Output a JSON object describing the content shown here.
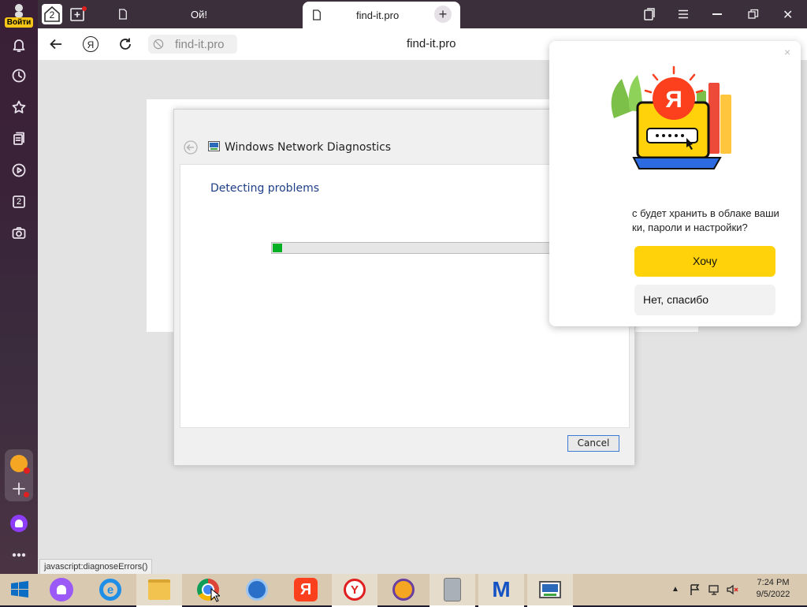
{
  "sidebar": {
    "login_label": "Войти",
    "badge_count": "2"
  },
  "tabs": {
    "group_count": "2",
    "tab1_title": "Ой!",
    "tab2_title": "find-it.pro"
  },
  "toolbar": {
    "address": "find-it.pro",
    "page_title": "find-it.pro"
  },
  "dialog": {
    "title": "Windows Network Diagnostics",
    "heading": "Detecting problems",
    "progress_fraction": 0.035,
    "cancel_label": "Cancel",
    "close_label": "×"
  },
  "popup": {
    "message": "с будет хранить в облаке ваши\nки, пароли и настройки?",
    "yes_label": "Хочу",
    "no_label": "Нет, спасибо",
    "close_label": "×"
  },
  "status": {
    "link": "javascript:diagnoseErrors()"
  },
  "taskbar": {
    "time": "7:24 PM",
    "date": "9/5/2022"
  },
  "colors": {
    "progress_green": "#06b025",
    "yandex_red": "#fc3f1d",
    "yandex_yellow": "#ffd20a",
    "heading_blue": "#1e3f87"
  }
}
